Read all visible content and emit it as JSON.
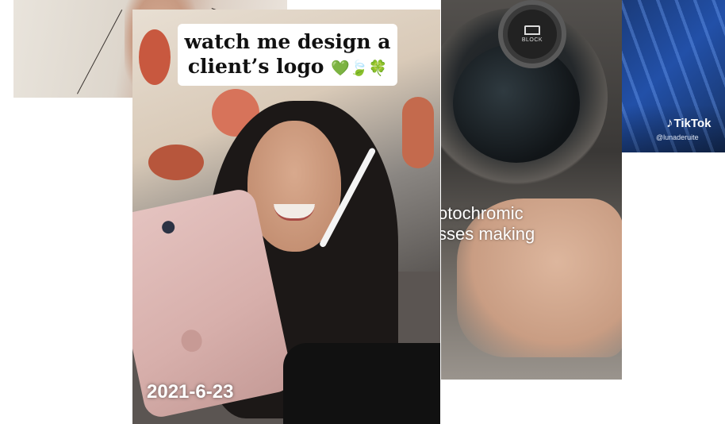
{
  "main_video": {
    "title_line1": "watch me design a",
    "title_line2": "client’s logo",
    "title_emojis": "💚🍃🍀",
    "date": "2021-6-23"
  },
  "product_video": {
    "badge_text": "BLOCK",
    "caption_line1": "otochromic",
    "caption_line2": "sses making"
  },
  "right_video": {
    "brand": "TikTok",
    "handle": "@lunaderuite"
  }
}
